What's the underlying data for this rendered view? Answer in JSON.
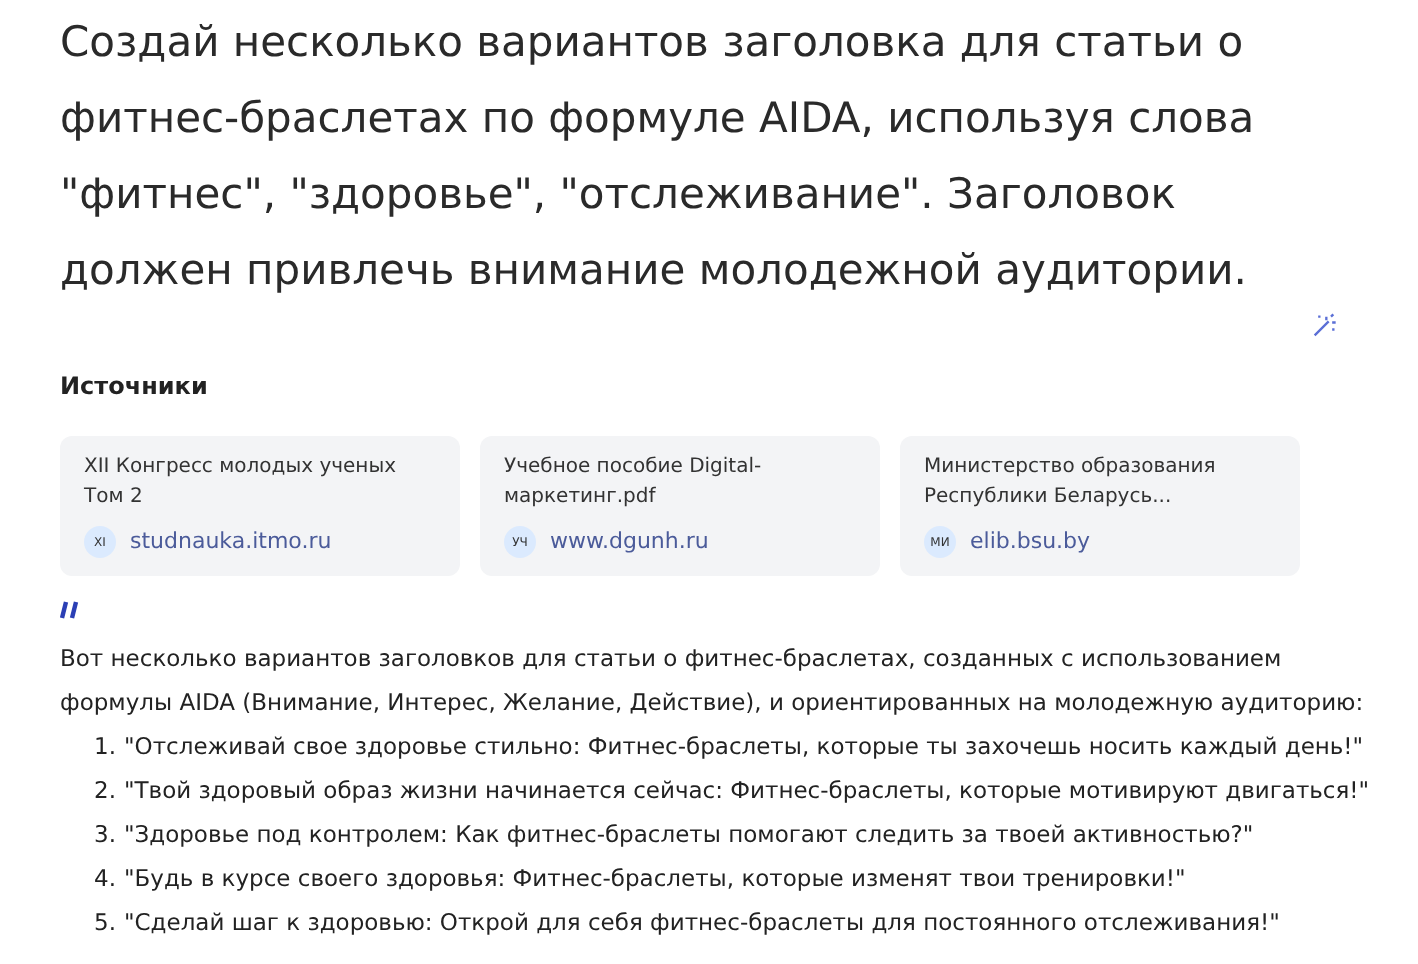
{
  "prompt": "Создай несколько вариантов заголовка для статьи о фитнес-браслетах по формуле AIDA, используя слова \"фитнес\", \"здоровье\", \"отслеживание\". Заголовок должен привлечь внимание молодежной аудитории.",
  "sources": {
    "title": "Источники",
    "items": [
      {
        "title": "XII Конгресс молодых ученых Том 2",
        "badge": "XI",
        "domain": "studnauka.itmo.ru"
      },
      {
        "title": "Учебное пособие Digital-маркетинг.pdf",
        "badge": "УЧ",
        "domain": "www.dgunh.ru"
      },
      {
        "title": "Министерство образования Республики Беларусь...",
        "badge": "МИ",
        "domain": "elib.bsu.by"
      }
    ]
  },
  "answer": {
    "intro": "Вот несколько вариантов заголовков для статьи о фитнес-браслетах, созданных с использованием формулы AIDA (Внимание, Интерес, Желание, Действие), и ориентированных на молодежную аудиторию:",
    "items": [
      {
        "number": "1.",
        "text": "\"Отслеживай свое здоровье стильно: Фитнес-браслеты, которые ты захочешь носить каждый день!\""
      },
      {
        "number": "2.",
        "text": "\"Твой здоровый образ жизни начинается сейчас: Фитнес-браслеты, которые мотивируют двигаться!\""
      },
      {
        "number": "3.",
        "text": "\"Здоровье под контролем: Как фитнес-браслеты помогают следить за твоей активностью?\""
      },
      {
        "number": "4.",
        "text": "\"Будь в курсе своего здоровья: Фитнес-браслеты, которые изменят твои тренировки!\""
      },
      {
        "number": "5.",
        "text": "\"Сделай шаг к здоровью: Открой для себя фитнес-браслеты для постоянного отслеживания!\""
      }
    ]
  }
}
